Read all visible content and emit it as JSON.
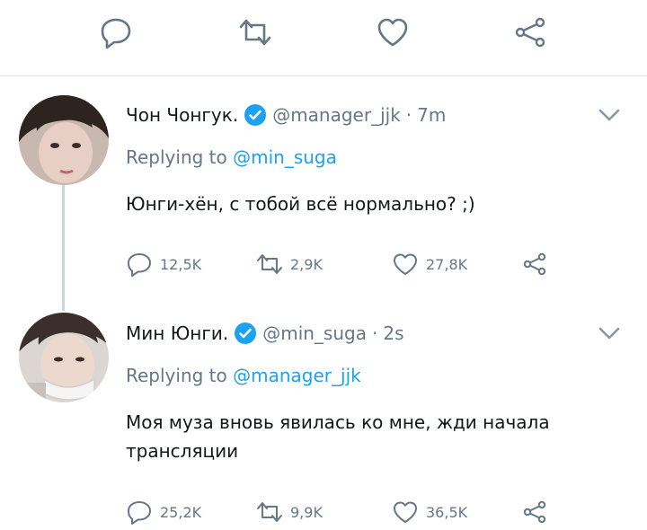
{
  "colors": {
    "accent": "#1da1f2",
    "muted": "#657786",
    "text": "#14171a",
    "divider": "#e1e8ed"
  },
  "top_actions": [
    "reply-icon",
    "retweet-icon",
    "like-icon",
    "share-icon"
  ],
  "tweets": [
    {
      "name": "Чон Чонгук.",
      "verified": true,
      "handle": "@manager_jjk",
      "separator": "·",
      "time": "7m",
      "replying_prefix": "Replying to",
      "replying_to": "@min_suga",
      "text": "Юнги-хён, с тобой всё нормально? ;)",
      "replies": "12,5K",
      "retweets": "2,9K",
      "likes": "27,8K"
    },
    {
      "name": "Мин Юнги.",
      "verified": true,
      "handle": "@min_suga",
      "separator": "·",
      "time": "2s",
      "replying_prefix": "Replying to",
      "replying_to": "@manager_jjk",
      "text": "Моя муза вновь явилась ко мне, жди начала трансляции",
      "replies": "25,2K",
      "retweets": "9,9K",
      "likes": "36,5K"
    }
  ]
}
